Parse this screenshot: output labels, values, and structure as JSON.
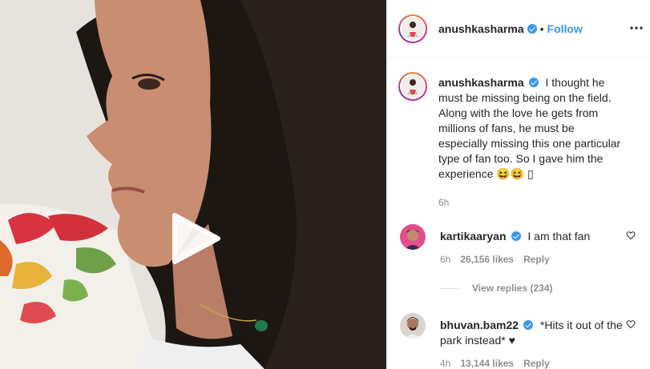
{
  "post": {
    "author": "anushkasharma",
    "follow_label": "Follow",
    "separator": "•",
    "caption": "I thought he must be missing being on the field. Along with the love he gets from millions of fans, he must be especially missing this one particular type of fan too. So I gave him the experience 😆😆",
    "caption_tail": "▯",
    "time": "6h"
  },
  "comments": [
    {
      "user": "kartikaaryan",
      "text": "I am that fan",
      "time": "6h",
      "likes": "26,156 likes",
      "reply": "Reply",
      "view_replies": "View replies (234)"
    },
    {
      "user": "bhuvan.bam22",
      "text": "*Hits it out of the park instead* ♥",
      "time": "4h",
      "likes": "13,144 likes",
      "reply": "Reply"
    }
  ],
  "icons": {
    "play": "play-icon",
    "more": "more-options-icon",
    "heart": "heart-icon",
    "verified": "verified-badge-icon"
  },
  "colors": {
    "link": "#3897f0",
    "muted": "#8e8e8e",
    "text": "#262626"
  }
}
